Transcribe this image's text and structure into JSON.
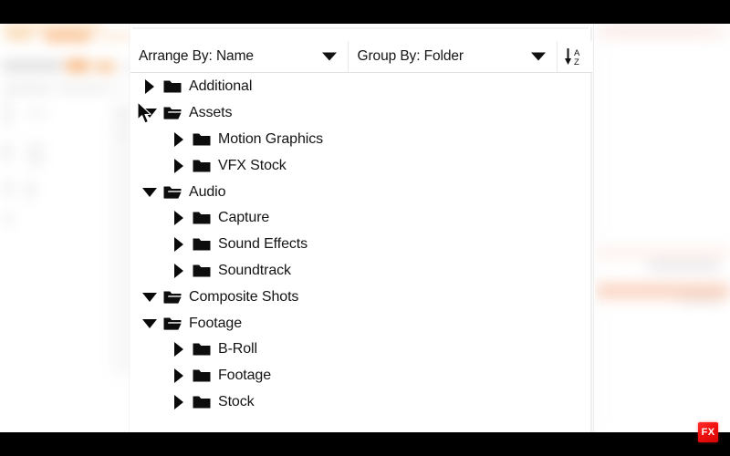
{
  "app": {
    "overlay_badge": "FX",
    "accent_color": "#f0100f",
    "panel_background": "#ffffff",
    "text_color": "#141414"
  },
  "toolbar": {
    "arrange_by": {
      "label": "Arrange By: Name",
      "caret_icon": "chevron-down-icon"
    },
    "group_by": {
      "label": "Group By: Folder",
      "caret_icon": "chevron-down-icon"
    },
    "sort_button": {
      "icon": "sort-az-descending-icon",
      "letter_top": "A",
      "letter_bottom": "Z"
    }
  },
  "tree": {
    "items": [
      {
        "label": "Additional",
        "depth": 0,
        "expanded": false,
        "folder_icon": "folder-closed-icon",
        "disclosure_icon": "triangle-right-icon"
      },
      {
        "label": "Assets",
        "depth": 0,
        "expanded": true,
        "folder_icon": "folder-open-icon",
        "disclosure_icon": "triangle-down-icon"
      },
      {
        "label": "Motion Graphics",
        "depth": 1,
        "expanded": false,
        "folder_icon": "folder-closed-icon",
        "disclosure_icon": "triangle-right-icon"
      },
      {
        "label": "VFX Stock",
        "depth": 1,
        "expanded": false,
        "folder_icon": "folder-closed-icon",
        "disclosure_icon": "triangle-right-icon"
      },
      {
        "label": "Audio",
        "depth": 0,
        "expanded": true,
        "folder_icon": "folder-open-icon",
        "disclosure_icon": "triangle-down-icon"
      },
      {
        "label": "Capture",
        "depth": 1,
        "expanded": false,
        "folder_icon": "folder-closed-icon",
        "disclosure_icon": "triangle-right-icon"
      },
      {
        "label": "Sound Effects",
        "depth": 1,
        "expanded": false,
        "folder_icon": "folder-closed-icon",
        "disclosure_icon": "triangle-right-icon"
      },
      {
        "label": "Soundtrack",
        "depth": 1,
        "expanded": false,
        "folder_icon": "folder-closed-icon",
        "disclosure_icon": "triangle-right-icon"
      },
      {
        "label": "Composite Shots",
        "depth": 0,
        "expanded": true,
        "folder_icon": "folder-open-icon",
        "disclosure_icon": "triangle-down-icon"
      },
      {
        "label": "Footage",
        "depth": 0,
        "expanded": true,
        "folder_icon": "folder-open-icon",
        "disclosure_icon": "triangle-down-icon"
      },
      {
        "label": "B-Roll",
        "depth": 1,
        "expanded": false,
        "folder_icon": "folder-closed-icon",
        "disclosure_icon": "triangle-right-icon"
      },
      {
        "label": "Footage",
        "depth": 1,
        "expanded": false,
        "folder_icon": "folder-closed-icon",
        "disclosure_icon": "triangle-right-icon"
      },
      {
        "label": "Stock",
        "depth": 1,
        "expanded": false,
        "folder_icon": "folder-closed-icon",
        "disclosure_icon": "triangle-right-icon"
      }
    ]
  },
  "cursor": {
    "icon": "mouse-pointer-icon"
  }
}
